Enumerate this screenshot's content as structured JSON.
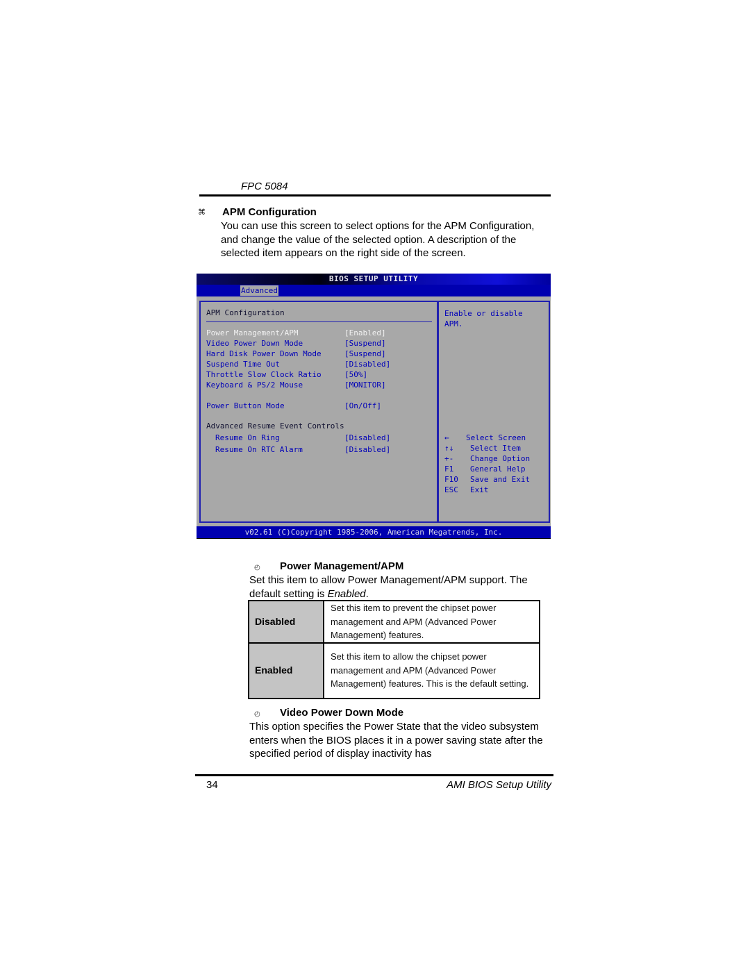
{
  "header": {
    "doc_title": "FPC 5084"
  },
  "section": {
    "bullet_icon": "⌘",
    "title": "APM Configuration",
    "paragraph": "You can use this screen to select options for the APM Configuration, and change the value of the selected option. A description of the selected item appears on the right side of the screen."
  },
  "bios": {
    "title": "BIOS SETUP UTILITY",
    "active_tab": "Advanced",
    "heading": "APM Configuration",
    "items": [
      {
        "label": "Power Management/APM",
        "value": "[Enabled]",
        "selected": true
      },
      {
        "label": "Video Power Down Mode",
        "value": "[Suspend]"
      },
      {
        "label": "Hard Disk Power Down Mode",
        "value": "[Suspend]"
      },
      {
        "label": "Suspend Time Out",
        "value": "[Disabled]"
      },
      {
        "label": "Throttle Slow Clock Ratio",
        "value": "[50%]"
      },
      {
        "label": "Keyboard & PS/2 Mouse",
        "value": "[MONITOR]"
      },
      {
        "label": "Power Button Mode",
        "value": "[On/Off]"
      }
    ],
    "subheading": "Advanced Resume Event Controls",
    "sub_items": [
      {
        "label": "Resume On Ring",
        "value": "[Disabled]"
      },
      {
        "label": "Resume On RTC Alarm",
        "value": "[Disabled]"
      }
    ],
    "help_text": "Enable or disable APM.",
    "keys": [
      {
        "key": "←",
        "action": "Select Screen"
      },
      {
        "key": "↑↓",
        "action": "Select Item"
      },
      {
        "key": "+-",
        "action": "Change Option"
      },
      {
        "key": "F1",
        "action": "General Help"
      },
      {
        "key": "F10",
        "action": "Save and Exit"
      },
      {
        "key": "ESC",
        "action": "Exit"
      }
    ],
    "footer": "v02.61 (C)Copyright 1985-2006, American Megatrends, Inc."
  },
  "subsections": [
    {
      "icon": "◴",
      "title": "Power Management/APM",
      "text_before": "Set this item to allow Power Management/APM support. The default setting is ",
      "text_emphasis": "Enabled",
      "text_after": "."
    },
    {
      "icon": "◴",
      "title": "Video Power Down Mode",
      "text": "This option specifies the Power State that the video subsystem enters when the BIOS places it in a power saving state after the specified period of display inactivity has"
    }
  ],
  "options_table": [
    {
      "option": "Disabled",
      "description": "Set this item to prevent the chipset power management and APM (Advanced Power Management) features."
    },
    {
      "option": "Enabled",
      "description": "Set this item to allow the chipset power management and APM (Advanced Power Management) features. This is the default setting."
    }
  ],
  "footer": {
    "page_number": "34",
    "doc_section": "AMI BIOS Setup Utility"
  }
}
